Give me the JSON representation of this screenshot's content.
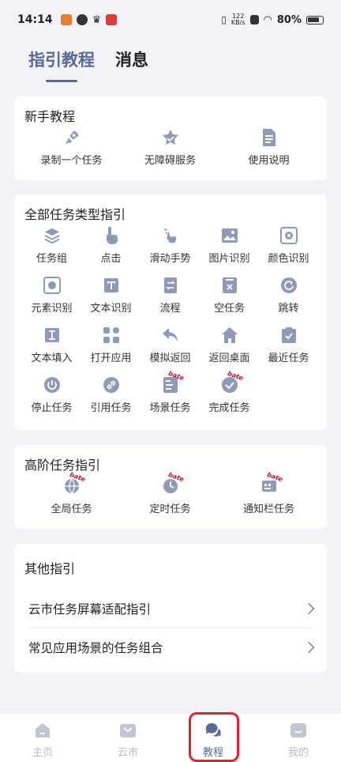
{
  "status_bar": {
    "time": "14:14",
    "net_speed_value": "122",
    "net_speed_unit": "KB/s",
    "battery": "80%"
  },
  "top_tabs": [
    {
      "label": "指引教程",
      "active": true
    },
    {
      "label": "消息",
      "active": false
    }
  ],
  "beginner": {
    "title": "新手教程",
    "items": [
      {
        "label": "录制一个任务",
        "icon": "rocket-icon"
      },
      {
        "label": "无障碍服务",
        "icon": "star-shield-icon"
      },
      {
        "label": "使用说明",
        "icon": "document-icon"
      }
    ]
  },
  "all_types": {
    "title": "全部任务类型指引",
    "items": [
      {
        "label": "任务组",
        "icon": "layers-icon"
      },
      {
        "label": "点击",
        "icon": "tap-icon"
      },
      {
        "label": "滑动手势",
        "icon": "swipe-icon"
      },
      {
        "label": "图片识别",
        "icon": "image-icon"
      },
      {
        "label": "颜色识别",
        "icon": "palette-icon"
      },
      {
        "label": "元素识别",
        "icon": "element-icon"
      },
      {
        "label": "文本识别",
        "icon": "text-t-icon"
      },
      {
        "label": "流程",
        "icon": "flow-icon"
      },
      {
        "label": "空任务",
        "icon": "empty-task-icon"
      },
      {
        "label": "跳转",
        "icon": "jump-icon"
      },
      {
        "label": "文本填入",
        "icon": "text-input-icon"
      },
      {
        "label": "打开应用",
        "icon": "apps-grid-icon"
      },
      {
        "label": "模拟返回",
        "icon": "back-arrow-icon"
      },
      {
        "label": "返回桌面",
        "icon": "home-icon"
      },
      {
        "label": "最近任务",
        "icon": "recent-tasks-icon"
      },
      {
        "label": "停止任务",
        "icon": "power-icon"
      },
      {
        "label": "引用任务",
        "icon": "link-icon"
      },
      {
        "label": "场景任务",
        "icon": "scene-icon",
        "beta": "bate"
      },
      {
        "label": "完成任务",
        "icon": "complete-check-icon",
        "beta": "bate"
      }
    ]
  },
  "advanced": {
    "title": "高阶任务指引",
    "items": [
      {
        "label": "全局任务",
        "icon": "globe-icon",
        "beta": "bate"
      },
      {
        "label": "定时任务",
        "icon": "clock-icon",
        "beta": "bate"
      },
      {
        "label": "通知栏任务",
        "icon": "notification-bar-icon",
        "beta": "bate"
      }
    ]
  },
  "other": {
    "title": "其他指引",
    "links": [
      {
        "label": "云市任务屏幕适配指引"
      },
      {
        "label": "常见应用场景的任务组合"
      }
    ]
  },
  "bottom_nav": [
    {
      "label": "主页",
      "icon": "home-nav-icon",
      "active": false
    },
    {
      "label": "云市",
      "icon": "market-nav-icon",
      "active": false
    },
    {
      "label": "教程",
      "icon": "chat-bubbles-nav-icon",
      "active": true
    },
    {
      "label": "我的",
      "icon": "profile-nav-icon",
      "active": false
    }
  ],
  "colors": {
    "accent": "#5a6a98",
    "icon": "#8f9ab8",
    "highlight": "#e3232c",
    "beta_text": "#c8102e"
  }
}
